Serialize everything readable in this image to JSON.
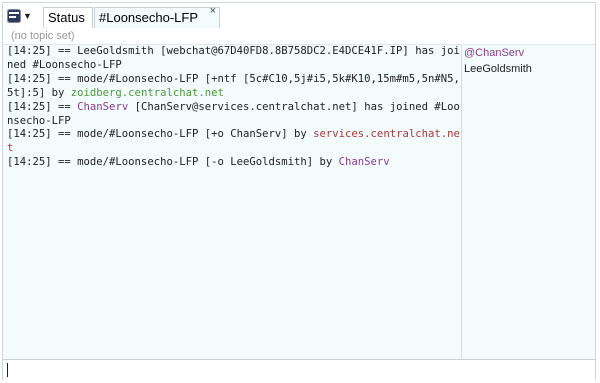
{
  "tabs": {
    "status_label": "Status",
    "channel_label": "#Loonsecho-LFP",
    "close_glyph": "×"
  },
  "icons": {
    "menu": "irc-app-icon",
    "menu_caret": "▼"
  },
  "topic": "(no topic set)",
  "colors": {
    "nick_link": "#4f9a3c",
    "chanserv": "#8a3c8e",
    "server": "#a83a3a",
    "background": "#f3fbfd"
  },
  "messages": [
    [
      {
        "text": "[14:25] == LeeGoldsmith [webchat@67D40FD8.8B758DC2.E4DCE41F.IP] has joined #Loonsecho-LFP"
      }
    ],
    [
      {
        "text": "[14:25] == mode/#Loonsecho-LFP [+ntf [5c#C10,5j#i5,5k#K10,15m#m5,5n#N5,5t]:5] by "
      },
      {
        "text": "zoidberg.centralchat.net",
        "style": "nick-link"
      }
    ],
    [
      {
        "text": "[14:25] == "
      },
      {
        "text": "ChanServ",
        "style": "chanserv"
      },
      {
        "text": " [ChanServ@services.centralchat.net] has joined #Loonsecho-LFP"
      }
    ],
    [
      {
        "text": "[14:25] == mode/#Loonsecho-LFP [+o ChanServ] by "
      },
      {
        "text": "services.centralchat.net",
        "style": "server"
      }
    ],
    [
      {
        "text": "[14:25] == mode/#Loonsecho-LFP [-o LeeGoldsmith] by "
      },
      {
        "text": "ChanServ",
        "style": "chanserv"
      }
    ]
  ],
  "users": [
    {
      "name": "@ChanServ",
      "style": "user-op"
    },
    {
      "name": "LeeGoldsmith",
      "style": "user-normal"
    }
  ],
  "input": {
    "value": "",
    "placeholder": ""
  }
}
